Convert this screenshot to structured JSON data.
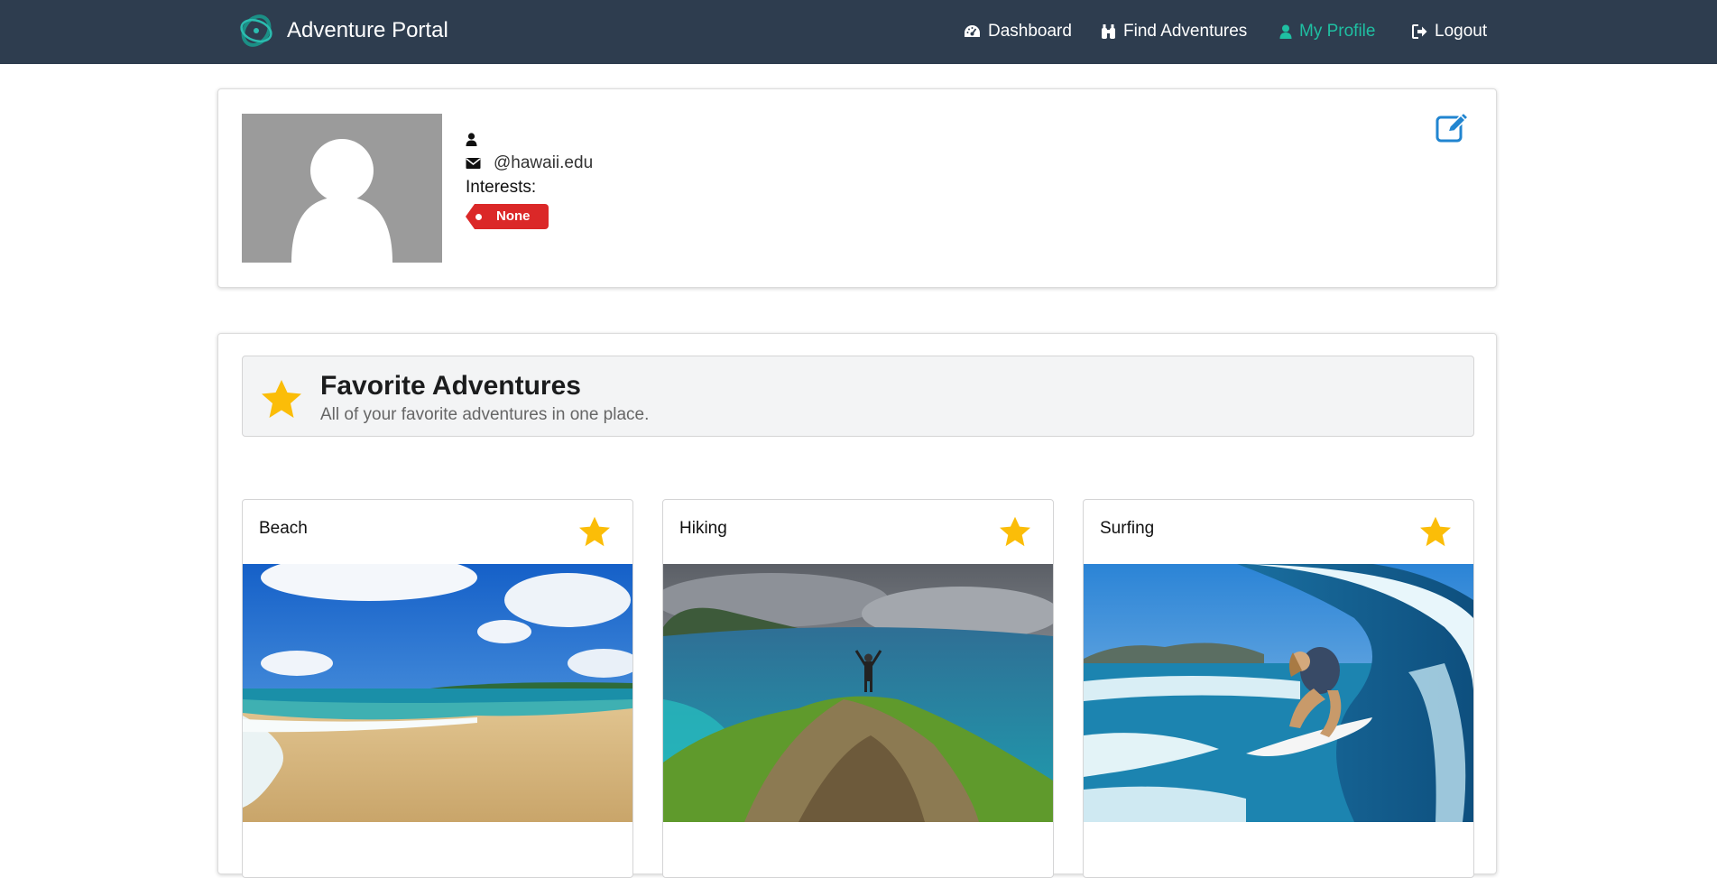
{
  "navbar": {
    "brand": "Adventure Portal",
    "items": [
      {
        "label": "Dashboard",
        "icon": "dashboard-icon"
      },
      {
        "label": "Find Adventures",
        "icon": "binoculars-icon"
      },
      {
        "label": "My Profile",
        "icon": "user-icon",
        "active": true
      },
      {
        "label": "Logout",
        "icon": "sign-out-icon"
      }
    ],
    "colors": {
      "background": "#2e3d4f",
      "active": "#1fbfa2"
    }
  },
  "profile": {
    "name": "",
    "email": "@hawaii.edu",
    "interests_label": "Interests:",
    "interests": [
      "None"
    ],
    "tag_color": "#db2828"
  },
  "favorites": {
    "title": "Favorite Adventures",
    "subtitle": "All of your favorite adventures in one place.",
    "star_color": "#fbbd08",
    "cards": [
      {
        "title": "Beach",
        "image": "beach-photo"
      },
      {
        "title": "Hiking",
        "image": "hiking-photo"
      },
      {
        "title": "Surfing",
        "image": "surfing-photo"
      }
    ]
  }
}
